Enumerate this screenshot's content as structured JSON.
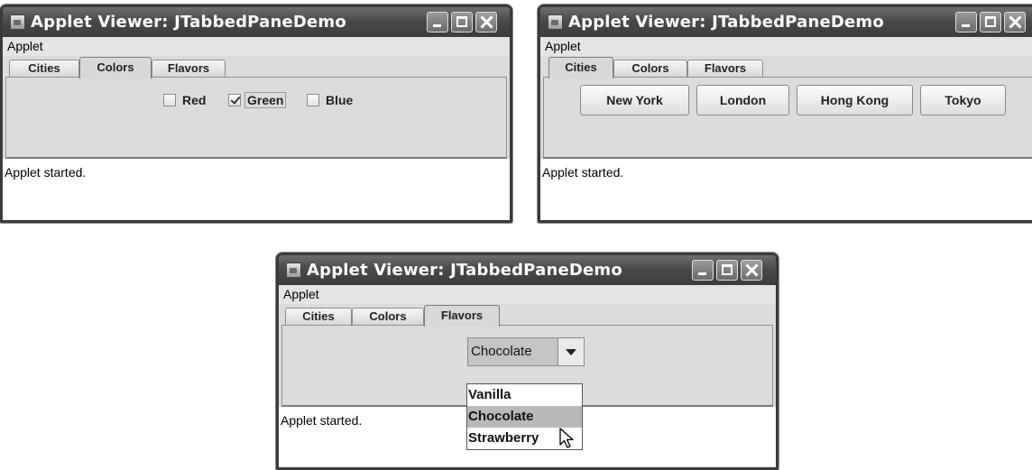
{
  "windows": {
    "colors": {
      "title": "Applet Viewer: JTabbedPaneDemo",
      "menu": [
        "Applet"
      ],
      "tabs": [
        "Cities",
        "Colors",
        "Flavors"
      ],
      "selected_tab": "Colors",
      "checkboxes": [
        {
          "label": "Red",
          "checked": false
        },
        {
          "label": "Green",
          "checked": true
        },
        {
          "label": "Blue",
          "checked": false
        }
      ],
      "status": "Applet started."
    },
    "cities": {
      "title": "Applet Viewer: JTabbedPaneDemo",
      "menu": [
        "Applet"
      ],
      "tabs": [
        "Cities",
        "Colors",
        "Flavors"
      ],
      "selected_tab": "Cities",
      "buttons": [
        "New York",
        "London",
        "Hong Kong",
        "Tokyo"
      ],
      "status": "Applet started."
    },
    "flavors": {
      "title": "Applet Viewer: JTabbedPaneDemo",
      "menu": [
        "Applet"
      ],
      "tabs": [
        "Cities",
        "Colors",
        "Flavors"
      ],
      "selected_tab": "Flavors",
      "combo_value": "Chocolate",
      "options": [
        "Vanilla",
        "Chocolate",
        "Strawberry"
      ],
      "highlighted_option": "Chocolate",
      "status": "Applet started."
    }
  },
  "icons": [
    "applet-icon",
    "minimize-icon",
    "maximize-icon",
    "close-icon",
    "checkmark-icon",
    "dropdown-arrow-icon",
    "mouse-cursor-icon"
  ],
  "colors": {
    "title_bar": "#4a4a4a",
    "window_bg": "#dcdcdc",
    "highlight": "#b9b9b9"
  }
}
